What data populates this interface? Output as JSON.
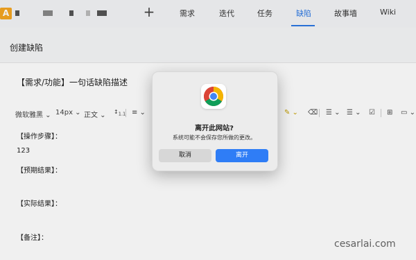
{
  "header": {
    "logo_letter": "A",
    "nav": [
      {
        "label": "需求",
        "active": false
      },
      {
        "label": "迭代",
        "active": false
      },
      {
        "label": "任务",
        "active": false
      },
      {
        "label": "缺陷",
        "active": true
      },
      {
        "label": "故事墙",
        "active": false
      },
      {
        "label": "Wiki",
        "active": false
      }
    ],
    "add_icon": "plus-icon"
  },
  "panel": {
    "title": "创建缺陷"
  },
  "form": {
    "summary_placeholder": "【需求/功能】一句话缺陷描述",
    "toolbar": {
      "font_family": "微软雅黑",
      "font_size": "14px",
      "paragraph": "正文",
      "line_height_icon": "line-height-icon",
      "icons": [
        "align-icon",
        "highlight-icon",
        "eraser-icon",
        "ordered-list-icon",
        "bullet-list-icon",
        "checklist-icon",
        "table-icon",
        "image-icon"
      ]
    },
    "body": {
      "steps_label": "【操作步骤】：",
      "steps_value": "123",
      "expected_label": "【预期结果】：",
      "actual_label": "【实际结果】：",
      "notes_label": "【备注】："
    }
  },
  "dialog": {
    "title": "离开此网站?",
    "message": "系统可能不会保存您所做的更改。",
    "cancel_label": "取消",
    "leave_label": "离开",
    "icon": "chrome-icon",
    "accent_color": "#2f7df6"
  },
  "watermark": "cesarlai.com"
}
